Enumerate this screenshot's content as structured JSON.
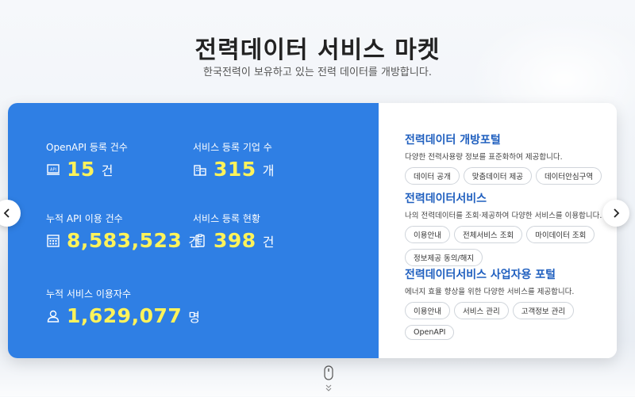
{
  "header": {
    "title": "전력데이터 서비스 마켓",
    "subtitle": "한국전력이 보유하고 있는 전력 데이터를 개방합니다."
  },
  "stats": [
    {
      "label": "OpenAPI 등록 건수",
      "value": "15",
      "unit": "건",
      "icon": "api-icon"
    },
    {
      "label": "서비스 등록 기업 수",
      "value": "315",
      "unit": "개",
      "icon": "building-icon"
    },
    {
      "label": "누적 API 이용 건수",
      "value": "8,583,523",
      "unit": "건",
      "icon": "calculator-icon"
    },
    {
      "label": "서비스 등록 현황",
      "value": "398",
      "unit": "건",
      "icon": "document-icon"
    },
    {
      "label": "누적 서비스 이용자수",
      "value": "1,629,077",
      "unit": "명",
      "icon": "user-icon"
    }
  ],
  "sections": [
    {
      "title": "전력데이터 개방포털",
      "description": "다양한 전력사용량 정보를 표준화하여 제공합니다.",
      "tags": [
        "데이터 공개",
        "맞춤데이터 제공",
        "데이터안심구역"
      ]
    },
    {
      "title": "전력데이터서비스",
      "description": "나의 전력데이터를 조회·제공하여 다양한 서비스를 이용합니다.",
      "tags": [
        "이용안내",
        "전체서비스 조회",
        "마이데이터 조회",
        "정보제공 동의/해지"
      ]
    },
    {
      "title": "전력데이터서비스 사업자용 포털",
      "description": "에너지 효율 향상을 위한 다양한 서비스를 제공합니다.",
      "tags": [
        "이용안내",
        "서비스 관리",
        "고객정보 관리",
        "OpenAPI"
      ]
    }
  ],
  "colors": {
    "stats_bg": "#2f7fe4",
    "highlight": "#fff35a",
    "link_title": "#1f5fbf"
  },
  "nav": {
    "prev_icon": "chevron-left-icon",
    "next_icon": "chevron-right-icon"
  },
  "scroll_hint_icon": "mouse-scroll-icon"
}
